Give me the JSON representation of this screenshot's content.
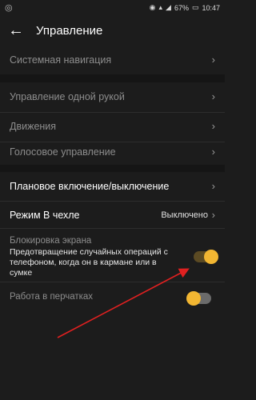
{
  "status": {
    "battery": "67%",
    "time": "10:47"
  },
  "header": {
    "title": "Управление"
  },
  "items": {
    "system_nav": "Системная навигация",
    "one_hand": "Управление одной рукой",
    "motions": "Движения",
    "voice": "Голосовое управление",
    "scheduled_power": "Плановое включение/выключение",
    "cover_mode": "Режим В чехле",
    "cover_mode_value": "Выключено",
    "screen_lock": "Блокировка экрана",
    "screen_lock_desc": "Предотвращение случайных операций с телефоном, когда он в кармане или в сумке",
    "gloves": "Работа в перчатках"
  },
  "toggles": {
    "screen_lock_on": true,
    "gloves_on": false
  },
  "colors": {
    "accent": "#f2b632",
    "arrow": "#e02020",
    "background": "#1c1c1c"
  }
}
